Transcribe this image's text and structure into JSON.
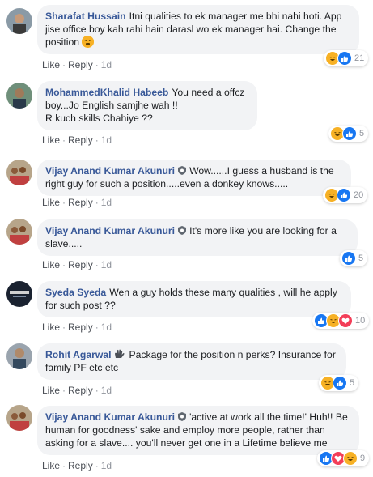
{
  "comments": [
    {
      "name": "Sharafat Hussain",
      "text": "Itni qualities to ek manager me bhi nahi hoti. App jise office boy kah rahi hain darasl wo ek manager hai. Change the position",
      "like": "Like",
      "reply": "Reply",
      "time": "1d",
      "reaction_count": "21"
    },
    {
      "name": "MohammedKhalid Habeeb",
      "text": "You need a offcz boy...Jo English samjhe wah !!",
      "text2": "R kuch skills Chahiye ??",
      "like": "Like",
      "reply": "Reply",
      "time": "1d",
      "reaction_count": "5"
    },
    {
      "name": "Vijay Anand Kumar Akunuri",
      "text": "Wow......I guess a husband is the right guy for such a position.....even a donkey knows.....",
      "like": "Like",
      "reply": "Reply",
      "time": "1d",
      "reaction_count": "20"
    },
    {
      "name": "Vijay Anand Kumar Akunuri",
      "text": "It's more like you are looking for a slave.....",
      "like": "Like",
      "reply": "Reply",
      "time": "1d",
      "reaction_count": "5"
    },
    {
      "name": "Syeda Syeda",
      "text": "Wen a guy holds these many qualities , will he apply for such post ??",
      "like": "Like",
      "reply": "Reply",
      "time": "1d",
      "reaction_count": "10"
    },
    {
      "name": "Rohit Agarwal",
      "text": "Package for the position n perks? Insurance for family PF etc etc",
      "like": "Like",
      "reply": "Reply",
      "time": "1d",
      "reaction_count": "5"
    },
    {
      "name": "Vijay Anand Kumar Akunuri",
      "text": "'active at work all the time!' Huh!! Be human for goodness' sake and employ more people, rather than asking for a slave.... you'll never get one in a Lifetime believe me",
      "like": "Like",
      "reply": "Reply",
      "time": "1d",
      "reaction_count": "9"
    }
  ],
  "colors": {
    "name": "#385898",
    "bubble": "#f2f3f5",
    "like": "#1877f2",
    "haha": "#f7b125",
    "love": "#f33e58"
  }
}
